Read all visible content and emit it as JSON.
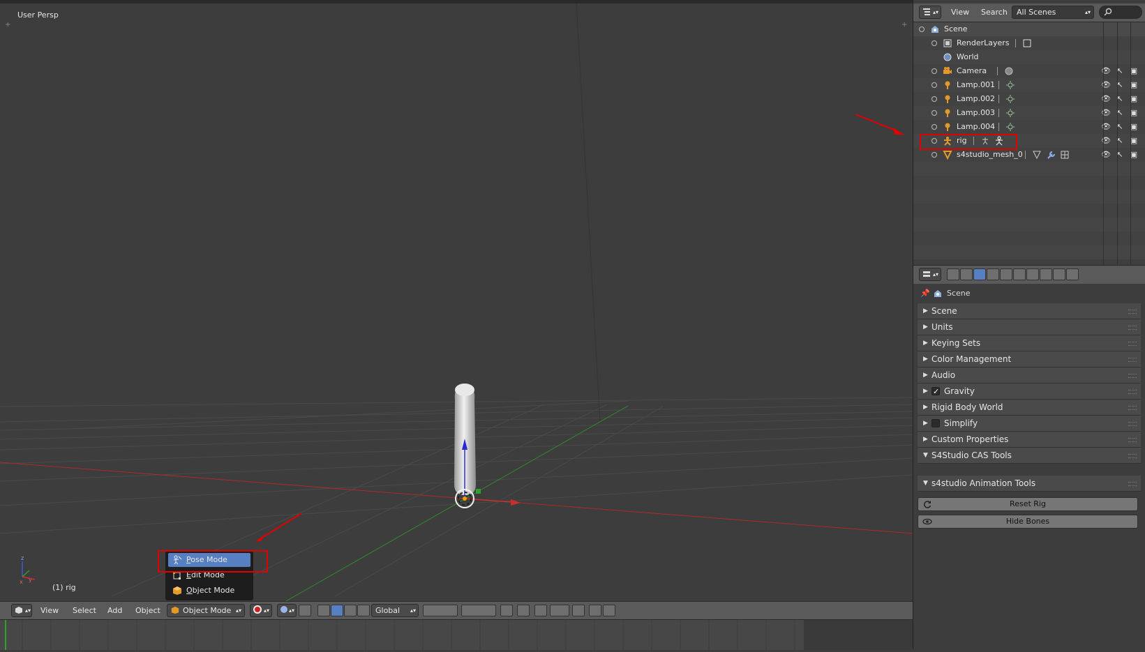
{
  "viewport": {
    "label": "User Persp",
    "object_label": "(1) rig"
  },
  "header3d": {
    "view": "View",
    "select": "Select",
    "add": "Add",
    "object": "Object",
    "mode": "Object Mode",
    "orientation": "Global"
  },
  "mode_menu": {
    "items": [
      {
        "label": "Pose Mode",
        "underline": "P",
        "rest": "ose Mode",
        "active": true
      },
      {
        "label": "Edit Mode",
        "underline": "E",
        "rest": "dit Mode",
        "active": false
      },
      {
        "label": "Object Mode",
        "underline": "O",
        "rest": "bject Mode",
        "active": false
      }
    ]
  },
  "outliner_header": {
    "view": "View",
    "search": "Search",
    "scenes": "All Scenes"
  },
  "outliner": {
    "rows": [
      {
        "name": "Scene",
        "indent": 0,
        "icon": "scene-icon"
      },
      {
        "name": "RenderLayers",
        "indent": 1,
        "icon": "renderlayers-icon"
      },
      {
        "name": "World",
        "indent": 1,
        "icon": "world-icon"
      },
      {
        "name": "Camera",
        "indent": 1,
        "icon": "camera-icon"
      },
      {
        "name": "Lamp.001",
        "indent": 1,
        "icon": "lamp-icon"
      },
      {
        "name": "Lamp.002",
        "indent": 1,
        "icon": "lamp-icon"
      },
      {
        "name": "Lamp.003",
        "indent": 1,
        "icon": "lamp-icon"
      },
      {
        "name": "Lamp.004",
        "indent": 1,
        "icon": "lamp-icon"
      },
      {
        "name": "rig",
        "indent": 1,
        "icon": "armature-icon"
      },
      {
        "name": "s4studio_mesh_0",
        "indent": 1,
        "icon": "mesh-icon"
      }
    ]
  },
  "properties": {
    "context": "Scene",
    "panels": [
      {
        "label": "Scene",
        "open": false,
        "checkbox": null
      },
      {
        "label": "Units",
        "open": false,
        "checkbox": null
      },
      {
        "label": "Keying Sets",
        "open": false,
        "checkbox": null
      },
      {
        "label": "Color Management",
        "open": false,
        "checkbox": null
      },
      {
        "label": "Audio",
        "open": false,
        "checkbox": null
      },
      {
        "label": "Gravity",
        "open": false,
        "checkbox": true
      },
      {
        "label": "Rigid Body World",
        "open": false,
        "checkbox": null
      },
      {
        "label": "Simplify",
        "open": false,
        "checkbox": false
      },
      {
        "label": "Custom Properties",
        "open": false,
        "checkbox": null
      },
      {
        "label": "S4Studio CAS Tools",
        "open": true,
        "checkbox": null
      },
      {
        "label": "s4studio Animation Tools",
        "open": true,
        "checkbox": null
      }
    ],
    "buttons": {
      "reset_rig": "Reset Rig",
      "hide_bones": "Hide Bones"
    }
  },
  "colors": {
    "highlight": "#e00000",
    "menu_active": "#5680c2",
    "x_axis": "#c83030",
    "y_axis": "#2ea02e",
    "z_axis": "#2a2ad0"
  }
}
